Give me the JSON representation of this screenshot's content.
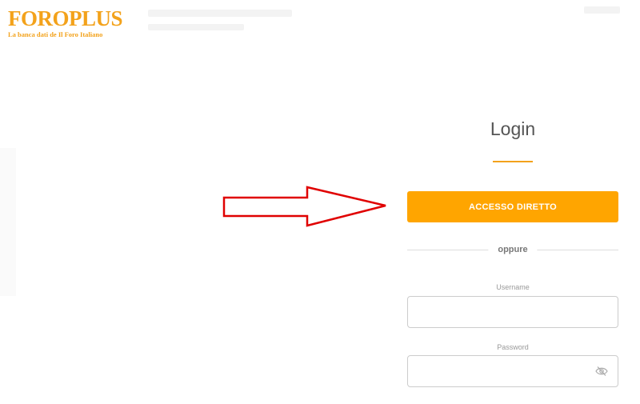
{
  "brand": {
    "title": "FOROPLUS",
    "subtitle": "La banca dati de  Il Foro Italiano",
    "color": "#f3a21b"
  },
  "login": {
    "title": "Login",
    "direct_access_label": "ACCESSO DIRETTO",
    "divider_text": "oppure",
    "username_label": "Username",
    "username_value": "",
    "password_label": "Password",
    "password_value": "",
    "accent_color": "#ffa500"
  },
  "annotation": {
    "arrow_color": "#e00000"
  },
  "icons": {
    "password_toggle": "eye-slash-icon",
    "annotation": "right-arrow-icon"
  }
}
